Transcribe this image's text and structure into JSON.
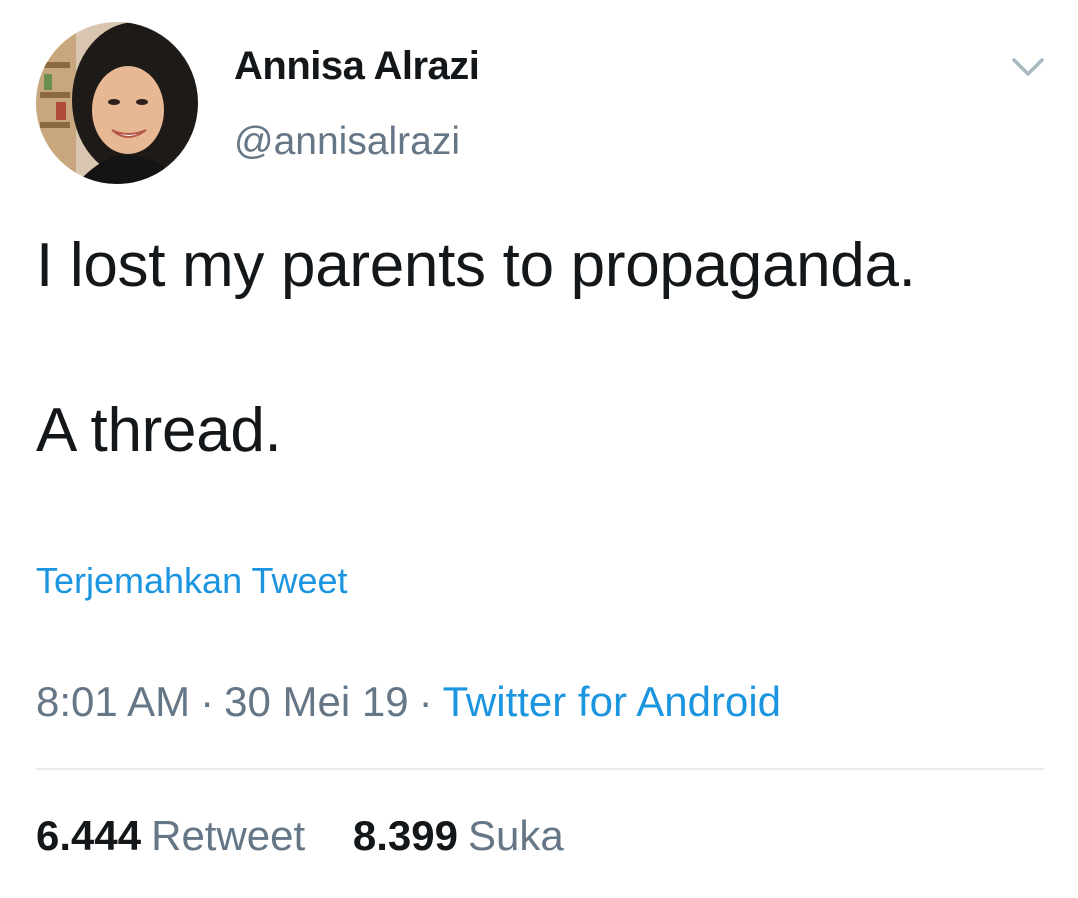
{
  "author": {
    "name": "Annisa Alrazi",
    "handle": "@annisalrazi"
  },
  "tweet": {
    "lines": [
      "I lost my parents to propaganda.",
      "A thread."
    ]
  },
  "translate_label": "Terjemahkan Tweet",
  "meta": {
    "time": "8:01 AM",
    "separator": "·",
    "date": "30 Mei 19",
    "source": "Twitter for Android"
  },
  "stats": {
    "retweets": {
      "count": "6.444",
      "label": "Retweet"
    },
    "likes": {
      "count": "8.399",
      "label": "Suka"
    }
  },
  "icons": {
    "menu": "chevron-down-icon"
  },
  "colors": {
    "text": "#14171a",
    "secondary": "#657786",
    "link": "#1b95e0",
    "divider": "#e6ecf0"
  }
}
